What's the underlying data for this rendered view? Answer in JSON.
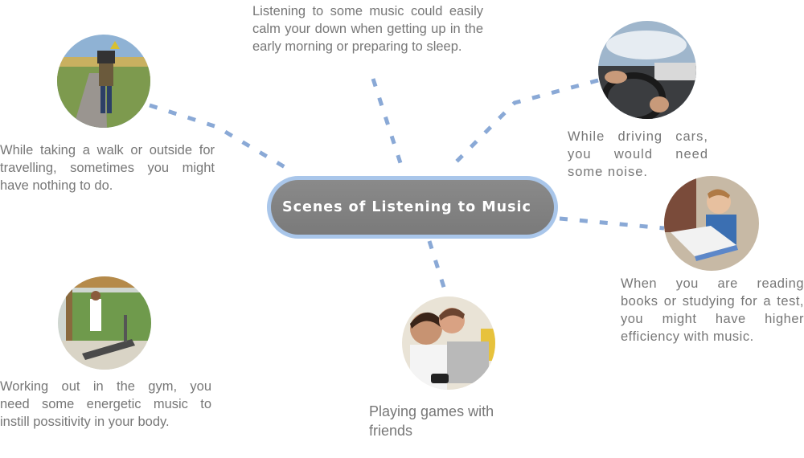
{
  "hub": {
    "title": "Scenes of Listening to Music"
  },
  "scenes": {
    "music_calm": "Listening to some music could easily calm your down when getting up in the early morning or preparing to sleep.",
    "walking_l1": "While taking a walk or outside for",
    "walking_l2": "travelling, sometimes you might",
    "walking_l3": "have nothing to do.",
    "driving_l1": "While driving cars,",
    "driving_l2": "you would need",
    "driving_l3": "some noise.",
    "reading_l1": "When you are reading",
    "reading_l2": "books or studying for a test,",
    "reading_l3": "you might have higher",
    "reading_l4": "efficiency with music.",
    "gym_l1": "Working out in the gym, you",
    "gym_l2": "need some energetic music to",
    "gym_l3": "instill possitivity in your body.",
    "games_l1": "Playing games with",
    "games_l2": "friends"
  },
  "colors": {
    "connector": "#8aa9d6",
    "hub_border": "#a9c6ea",
    "hub_fill": "#808080",
    "caption": "#777777"
  }
}
